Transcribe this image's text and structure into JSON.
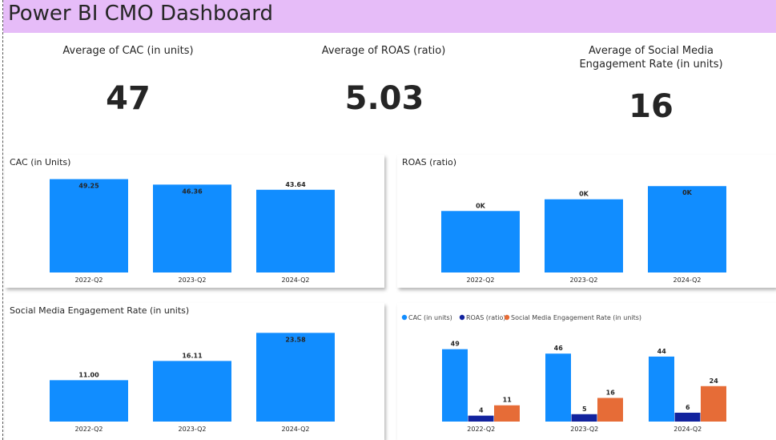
{
  "header": {
    "title": "Power BI CMO Dashboard"
  },
  "kpis": [
    {
      "label": "Average of CAC (in units)",
      "value": "47"
    },
    {
      "label": "Average of ROAS (ratio)",
      "value": "5.03"
    },
    {
      "label": "Average of Social Media Engagement Rate (in units)",
      "value": "16"
    }
  ],
  "colors": {
    "cac": "#118dff",
    "roas": "#12239e",
    "engagement": "#e66c37",
    "title_bg": "#e6bcf8"
  },
  "chart_data": [
    {
      "type": "bar",
      "title": "CAC (in Units)",
      "categories": [
        "2022-Q2",
        "2023-Q2",
        "2024-Q2"
      ],
      "values": [
        49.25,
        46.36,
        43.64
      ],
      "labels": [
        "49.25",
        "46.36",
        "43.64"
      ],
      "ylim": [
        0,
        52
      ]
    },
    {
      "type": "bar",
      "title": "ROAS (ratio)",
      "categories": [
        "2022-Q2",
        "2023-Q2",
        "2024-Q2"
      ],
      "values": [
        4.2,
        5.0,
        5.9
      ],
      "labels": [
        "0K",
        "0K",
        "0K"
      ],
      "ylim": [
        0,
        7.5
      ]
    },
    {
      "type": "bar",
      "title": "Social Media Engagement Rate (in units)",
      "categories": [
        "2022-Q2",
        "2023-Q2",
        "2024-Q2"
      ],
      "values": [
        11.0,
        16.11,
        23.58
      ],
      "labels": [
        "11.00",
        "16.11",
        "23.58"
      ],
      "ylim": [
        0,
        24.5
      ]
    },
    {
      "type": "bar",
      "categories": [
        "2022-Q2",
        "2023-Q2",
        "2024-Q2"
      ],
      "legend": "top-left",
      "ylim": [
        0,
        51
      ],
      "series": [
        {
          "name": "CAC (in units)",
          "values": [
            49,
            46,
            44
          ],
          "color": "#118dff"
        },
        {
          "name": "ROAS (ratio)",
          "values": [
            4,
            5,
            6
          ],
          "color": "#12239e"
        },
        {
          "name": "Social Media Engagement Rate (in units)",
          "values": [
            11,
            16,
            24
          ],
          "color": "#e66c37"
        }
      ]
    }
  ]
}
